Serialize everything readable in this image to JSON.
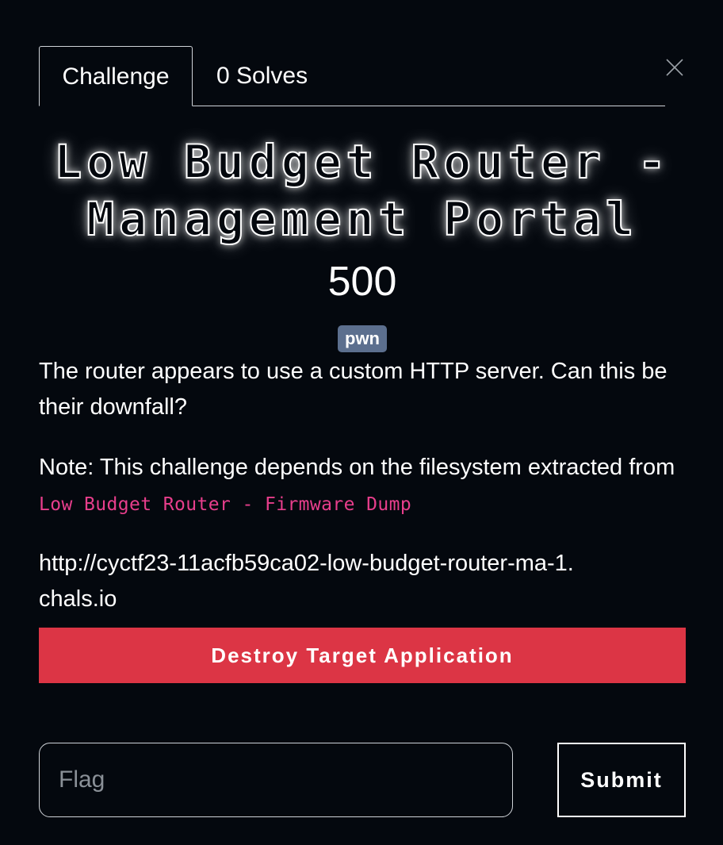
{
  "tabs": [
    {
      "label": "Challenge",
      "active": true
    },
    {
      "label": "0 Solves",
      "active": false
    }
  ],
  "close_icon": "close-icon",
  "challenge": {
    "title": "Low Budget Router - Management Portal",
    "points": "500",
    "category": "pwn",
    "description": "The router appears to use a custom HTTP server. Can this be their downfall?",
    "note": "Note: This challenge depends on the filesystem extracted from",
    "dependency": "Low Budget Router - Firmware Dump",
    "connection": "http://cyctf23-11acfb59ca02-low-budget-router-ma-1.chals.io"
  },
  "actions": {
    "destroy_label": "Destroy Target Application",
    "flag_placeholder": "Flag",
    "submit_label": "Submit"
  },
  "colors": {
    "background": "#04080e",
    "danger": "#dc3545",
    "badge": "#5c6f8e",
    "code": "#e83e8c"
  }
}
